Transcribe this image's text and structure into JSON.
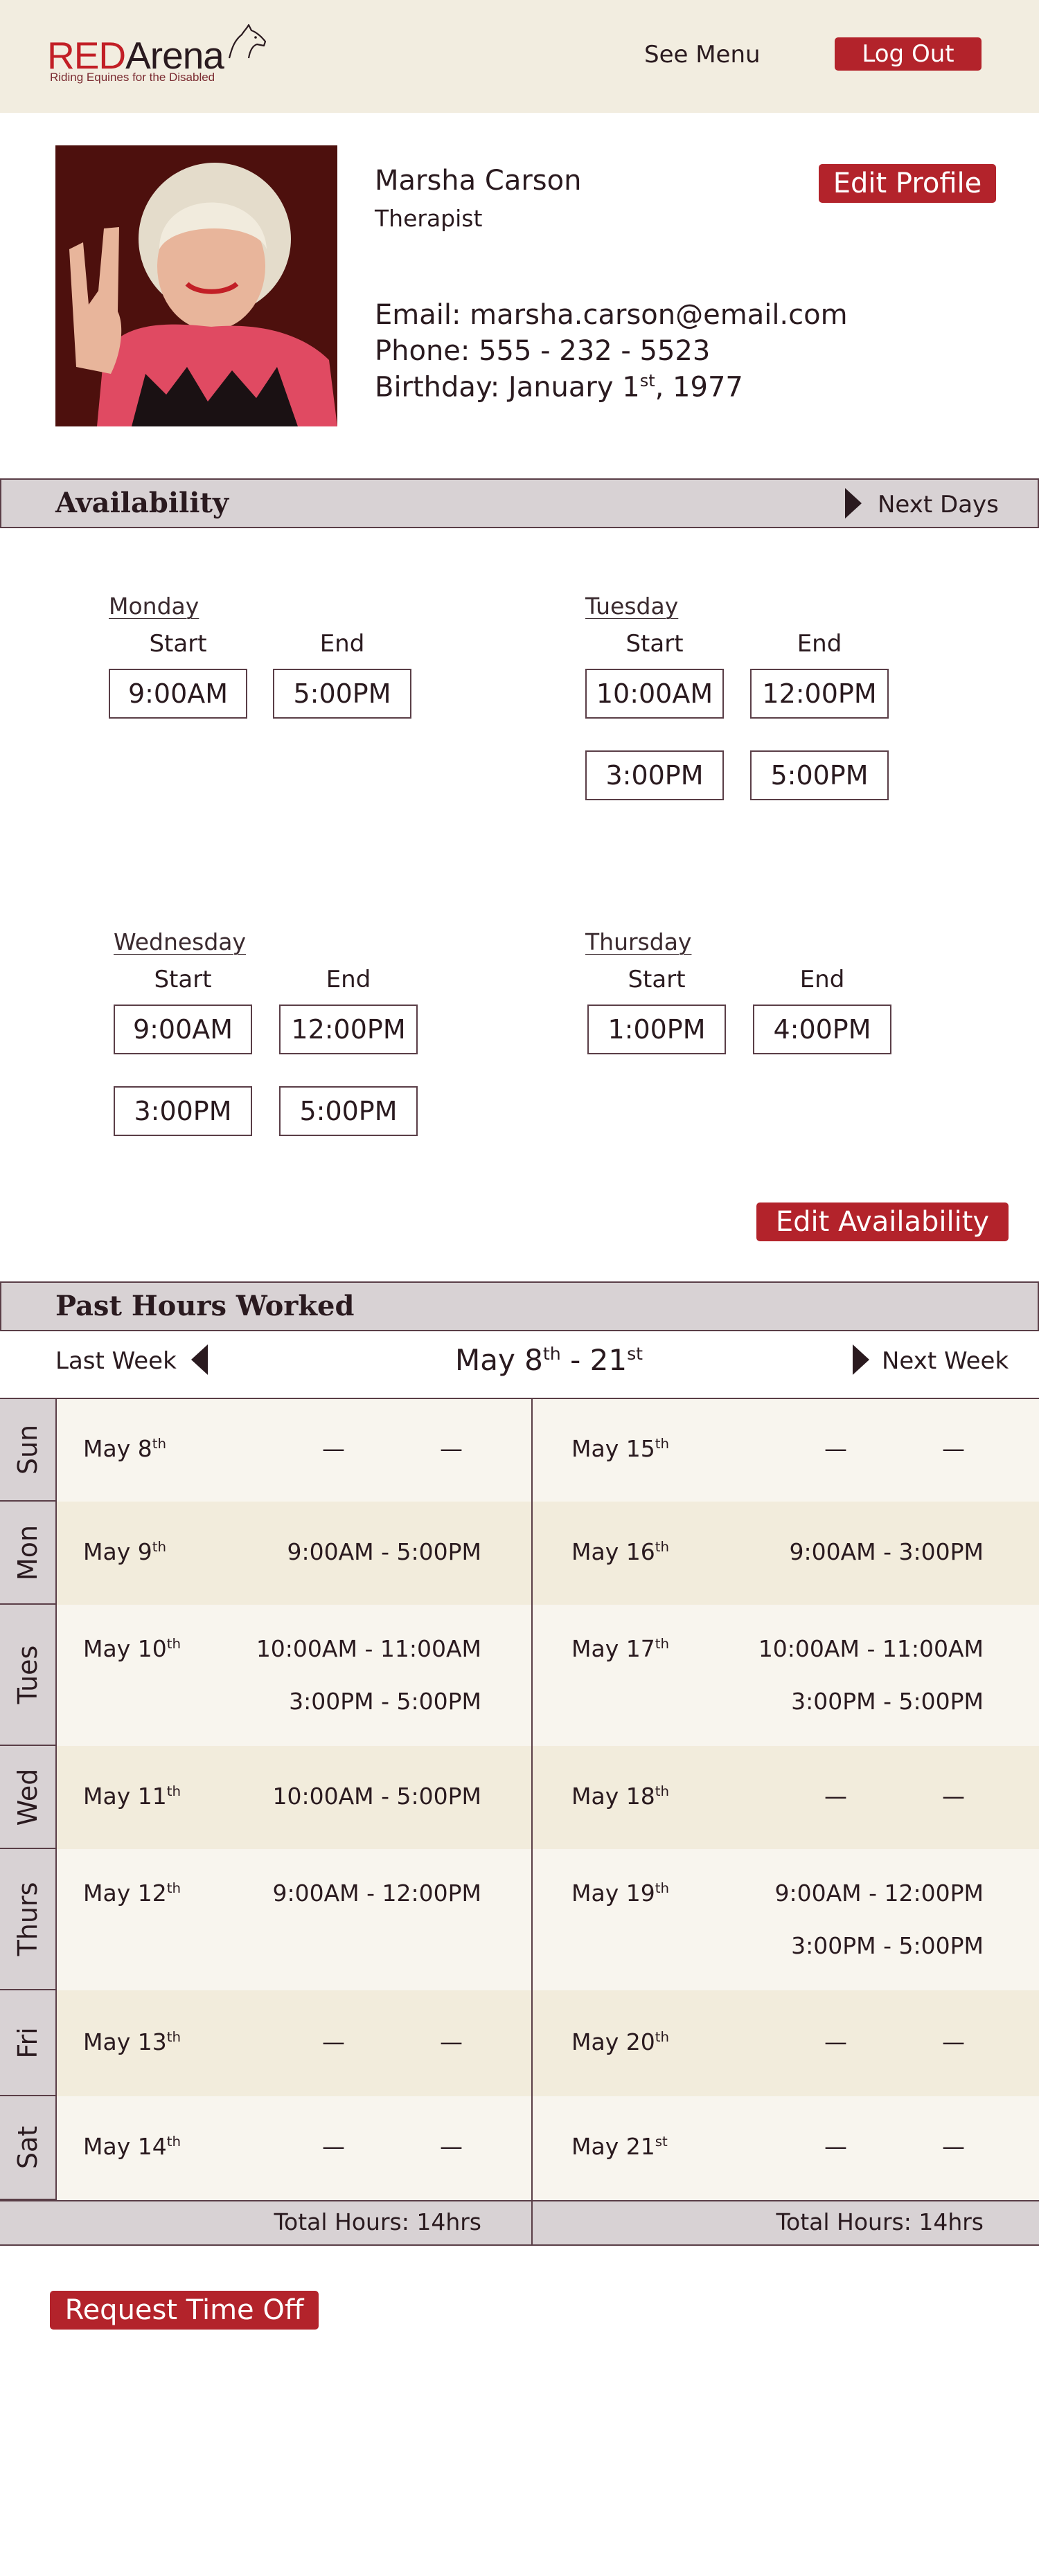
{
  "header": {
    "logo_red": "RED",
    "logo_dark": "Arena",
    "logo_tagline": "Riding Equines for the Disabled",
    "see_menu": "See Menu",
    "log_out": "Log Out"
  },
  "profile": {
    "name": "Marsha Carson",
    "role": "Therapist",
    "edit_label": "Edit Profile",
    "email": "Email: marsha.carson@email.com",
    "phone": "Phone: 555 - 232 - 5523",
    "birthday_prefix": "Birthday: January 1",
    "birthday_sup": "st",
    "birthday_suffix": ", 1977"
  },
  "availability": {
    "title": "Availability",
    "next_days": "Next Days",
    "start_label": "Start",
    "end_label": "End",
    "days": [
      {
        "name": "Monday",
        "slots": [
          [
            "9:00AM",
            "5:00PM"
          ]
        ]
      },
      {
        "name": "Tuesday",
        "slots": [
          [
            "10:00AM",
            "12:00PM"
          ],
          [
            "3:00PM",
            "5:00PM"
          ]
        ]
      },
      {
        "name": "Wednesday",
        "slots": [
          [
            "9:00AM",
            "12:00PM"
          ],
          [
            "3:00PM",
            "5:00PM"
          ]
        ]
      },
      {
        "name": "Thursday",
        "slots": [
          [
            "1:00PM",
            "4:00PM"
          ]
        ]
      }
    ],
    "edit_label": "Edit Availability"
  },
  "hours": {
    "title": "Past Hours Worked",
    "last_week": "Last Week",
    "next_week": "Next Week",
    "range_a": "May 8",
    "range_a_sup": "th",
    "range_b": " - 21",
    "range_b_sup": "st",
    "dash": "—",
    "days": [
      {
        "label": "Sun",
        "left": {
          "date": "May 8",
          "sup": "th",
          "times": []
        },
        "right": {
          "date": "May 15",
          "sup": "th",
          "times": []
        }
      },
      {
        "label": "Mon",
        "left": {
          "date": "May 9",
          "sup": "th",
          "times": [
            "9:00AM - 5:00PM"
          ]
        },
        "right": {
          "date": "May 16",
          "sup": "th",
          "times": [
            "9:00AM - 3:00PM"
          ]
        }
      },
      {
        "label": "Tues",
        "left": {
          "date": "May 10",
          "sup": "th",
          "times": [
            "10:00AM - 11:00AM",
            "3:00PM - 5:00PM"
          ]
        },
        "right": {
          "date": "May 17",
          "sup": "th",
          "times": [
            "10:00AM - 11:00AM",
            "3:00PM - 5:00PM"
          ]
        }
      },
      {
        "label": "Wed",
        "left": {
          "date": "May 11",
          "sup": "th",
          "times": [
            "10:00AM - 5:00PM"
          ]
        },
        "right": {
          "date": "May 18",
          "sup": "th",
          "times": []
        }
      },
      {
        "label": "Thurs",
        "left": {
          "date": "May 12",
          "sup": "th",
          "times": [
            "9:00AM - 12:00PM"
          ]
        },
        "right": {
          "date": "May 19",
          "sup": "th",
          "times": [
            "9:00AM - 12:00PM",
            "3:00PM - 5:00PM"
          ]
        }
      },
      {
        "label": "Fri",
        "left": {
          "date": "May 13",
          "sup": "th",
          "times": []
        },
        "right": {
          "date": "May 20",
          "sup": "th",
          "times": []
        }
      },
      {
        "label": "Sat",
        "left": {
          "date": "May 14",
          "sup": "th",
          "times": []
        },
        "right": {
          "date": "May 21",
          "sup": "st",
          "times": []
        }
      }
    ],
    "total_left": "Total Hours: 14hrs",
    "total_right": "Total Hours: 14hrs"
  },
  "request_time_off": "Request Time Off",
  "colors": {
    "brand_red": "#c21f26",
    "button_red": "#b3232b",
    "header_bg": "#f2ede0",
    "bar_bg": "#d8d2d4",
    "outline": "#5a3e47"
  },
  "icons": [
    "horse-head-logo",
    "triangle-right-icon",
    "triangle-left-icon"
  ]
}
